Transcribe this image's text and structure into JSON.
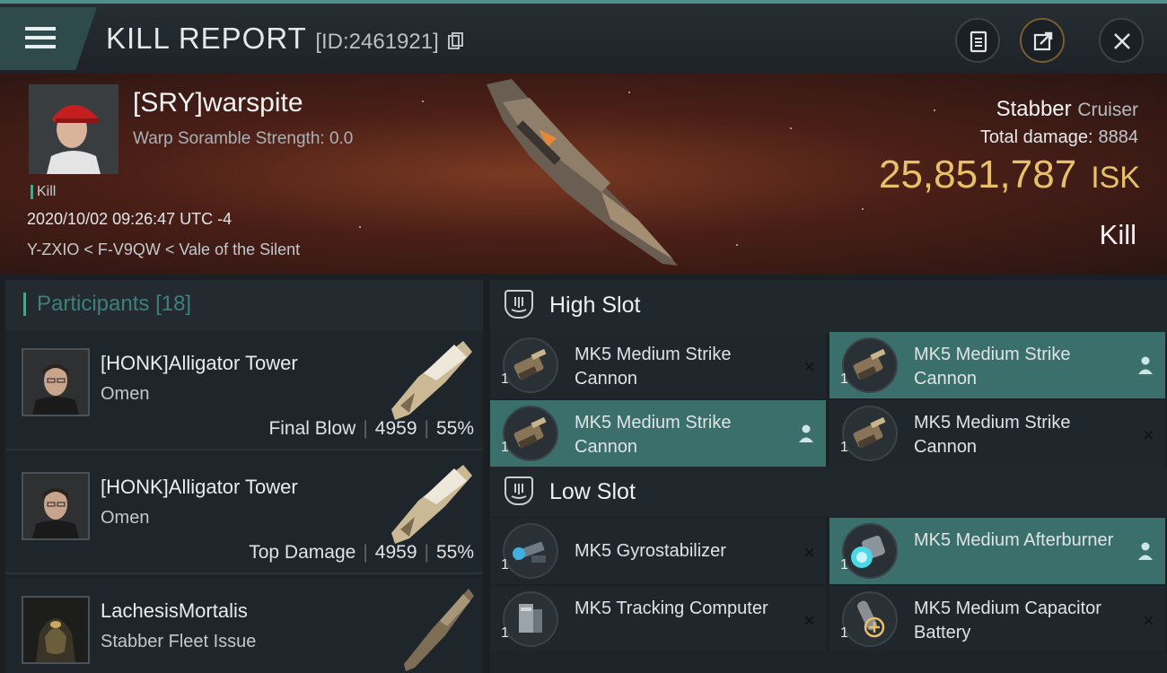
{
  "header": {
    "title": "KILL REPORT",
    "report_id": "[ID:2461921]"
  },
  "victim": {
    "name": "[SRY]warspite",
    "warp_scramble": "Warp Soramble Strength: 0.0",
    "kill_tag": "Kill",
    "datetime": "2020/10/02 09:26:47 UTC -4",
    "location": "Y-ZXIO < F-V9QW < Vale of the Silent",
    "ship_name": "Stabber",
    "ship_class": "Cruiser",
    "damage_label": "Total damage:",
    "damage_value": "8884",
    "isk_value": "25,851,787",
    "isk_unit": "ISK",
    "result": "Kill"
  },
  "participants": {
    "label": "Participants",
    "count": "[18]",
    "items": [
      {
        "name": "[HONK]Alligator Tower",
        "ship": "Omen",
        "role": "Final Blow",
        "damage": "4959",
        "percent": "55%"
      },
      {
        "name": "[HONK]Alligator Tower",
        "ship": "Omen",
        "role": "Top Damage",
        "damage": "4959",
        "percent": "55%"
      },
      {
        "name": "LachesisMortalis",
        "ship": "Stabber Fleet Issue",
        "role": "",
        "damage": "",
        "percent": ""
      }
    ]
  },
  "slots": {
    "high": {
      "label": "High Slot",
      "modules": [
        {
          "name": "MK5 Medium Strike Cannon",
          "qty": "1",
          "mark": "×",
          "highlight": false
        },
        {
          "name": "MK5 Medium Strike Cannon",
          "qty": "1",
          "mark": "person",
          "highlight": true
        },
        {
          "name": "MK5 Medium Strike Cannon",
          "qty": "1",
          "mark": "person",
          "highlight": true
        },
        {
          "name": "MK5 Medium Strike Cannon",
          "qty": "1",
          "mark": "×",
          "highlight": false
        }
      ]
    },
    "low": {
      "label": "Low Slot",
      "modules": [
        {
          "name": "MK5 Gyrostabilizer",
          "qty": "1",
          "mark": "×",
          "highlight": false
        },
        {
          "name": "MK5 Medium Afterburner",
          "qty": "1",
          "mark": "person",
          "highlight": true
        },
        {
          "name": "MK5 Tracking Computer",
          "qty": "1",
          "mark": "×",
          "highlight": false
        },
        {
          "name": "MK5 Medium Capacitor Battery",
          "qty": "1",
          "mark": "×",
          "highlight": false
        }
      ]
    }
  },
  "icons": {
    "menu": "menu-icon",
    "clipboard": "clipboard-icon",
    "share": "share-icon",
    "close": "close-icon",
    "copy": "copy-icon",
    "slot": "slot-icon",
    "person": "person-icon",
    "remove": "x-icon"
  },
  "colors": {
    "accent": "#4fa08e",
    "isk": "#e8c06a",
    "highlight": "#3b6f6c"
  }
}
